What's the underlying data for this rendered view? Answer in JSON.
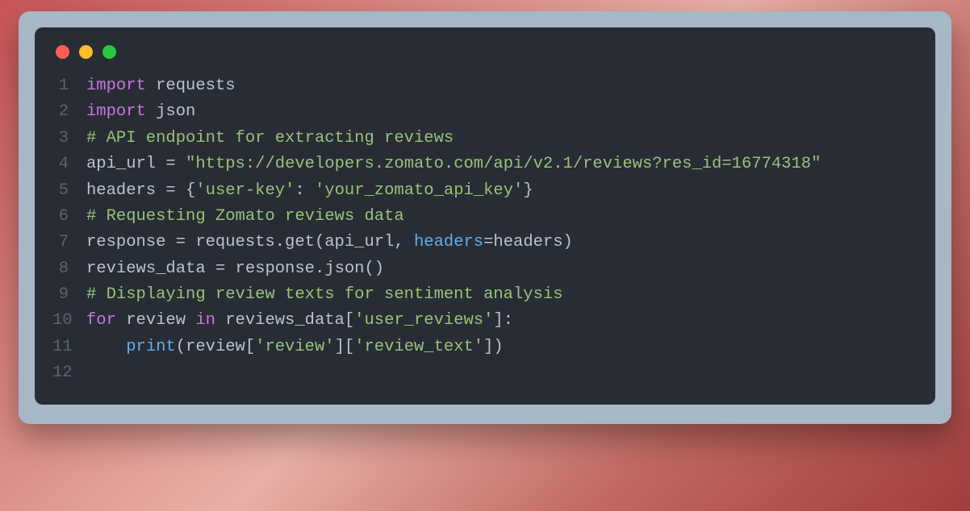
{
  "traffic": {
    "red": "close",
    "yellow": "minimize",
    "green": "zoom"
  },
  "code": {
    "lines": [
      {
        "n": "1",
        "tokens": [
          {
            "cls": "tok-keyword",
            "t": "import"
          },
          {
            "cls": "tok-default",
            "t": " requests"
          }
        ]
      },
      {
        "n": "2",
        "tokens": [
          {
            "cls": "tok-keyword",
            "t": "import"
          },
          {
            "cls": "tok-default",
            "t": " json"
          }
        ]
      },
      {
        "n": "3",
        "tokens": [
          {
            "cls": "tok-comment",
            "t": "# API endpoint for extracting reviews"
          }
        ]
      },
      {
        "n": "4",
        "tokens": [
          {
            "cls": "tok-default",
            "t": "api_url "
          },
          {
            "cls": "tok-op",
            "t": "="
          },
          {
            "cls": "tok-default",
            "t": " "
          },
          {
            "cls": "tok-string",
            "t": "\"https://developers.zomato.com/api/v2.1/reviews?res_id=16774318\""
          }
        ]
      },
      {
        "n": "5",
        "tokens": [
          {
            "cls": "tok-default",
            "t": "headers "
          },
          {
            "cls": "tok-op",
            "t": "="
          },
          {
            "cls": "tok-default",
            "t": " {"
          },
          {
            "cls": "tok-string",
            "t": "'user-key'"
          },
          {
            "cls": "tok-default",
            "t": ": "
          },
          {
            "cls": "tok-string",
            "t": "'your_zomato_api_key'"
          },
          {
            "cls": "tok-default",
            "t": "}"
          }
        ]
      },
      {
        "n": "6",
        "tokens": [
          {
            "cls": "tok-comment",
            "t": "# Requesting Zomato reviews data"
          }
        ]
      },
      {
        "n": "7",
        "tokens": [
          {
            "cls": "tok-default",
            "t": "response "
          },
          {
            "cls": "tok-op",
            "t": "="
          },
          {
            "cls": "tok-default",
            "t": " requests.get(api_url, "
          },
          {
            "cls": "tok-param",
            "t": "headers"
          },
          {
            "cls": "tok-op",
            "t": "="
          },
          {
            "cls": "tok-default",
            "t": "headers)"
          }
        ]
      },
      {
        "n": "8",
        "tokens": [
          {
            "cls": "tok-default",
            "t": "reviews_data "
          },
          {
            "cls": "tok-op",
            "t": "="
          },
          {
            "cls": "tok-default",
            "t": " response.json()"
          }
        ]
      },
      {
        "n": "9",
        "tokens": [
          {
            "cls": "tok-comment",
            "t": "# Displaying review texts for sentiment analysis"
          }
        ]
      },
      {
        "n": "10",
        "tokens": [
          {
            "cls": "tok-keyword",
            "t": "for"
          },
          {
            "cls": "tok-default",
            "t": " review "
          },
          {
            "cls": "tok-keyword",
            "t": "in"
          },
          {
            "cls": "tok-default",
            "t": " reviews_data["
          },
          {
            "cls": "tok-string",
            "t": "'user_reviews'"
          },
          {
            "cls": "tok-default",
            "t": "]:"
          }
        ]
      },
      {
        "n": "11",
        "tokens": [
          {
            "cls": "tok-default",
            "t": "    "
          },
          {
            "cls": "tok-func",
            "t": "print"
          },
          {
            "cls": "tok-default",
            "t": "(review["
          },
          {
            "cls": "tok-string",
            "t": "'review'"
          },
          {
            "cls": "tok-default",
            "t": "]["
          },
          {
            "cls": "tok-string",
            "t": "'review_text'"
          },
          {
            "cls": "tok-default",
            "t": "])"
          }
        ]
      },
      {
        "n": "12",
        "tokens": [
          {
            "cls": "tok-default",
            "t": ""
          }
        ]
      }
    ]
  }
}
